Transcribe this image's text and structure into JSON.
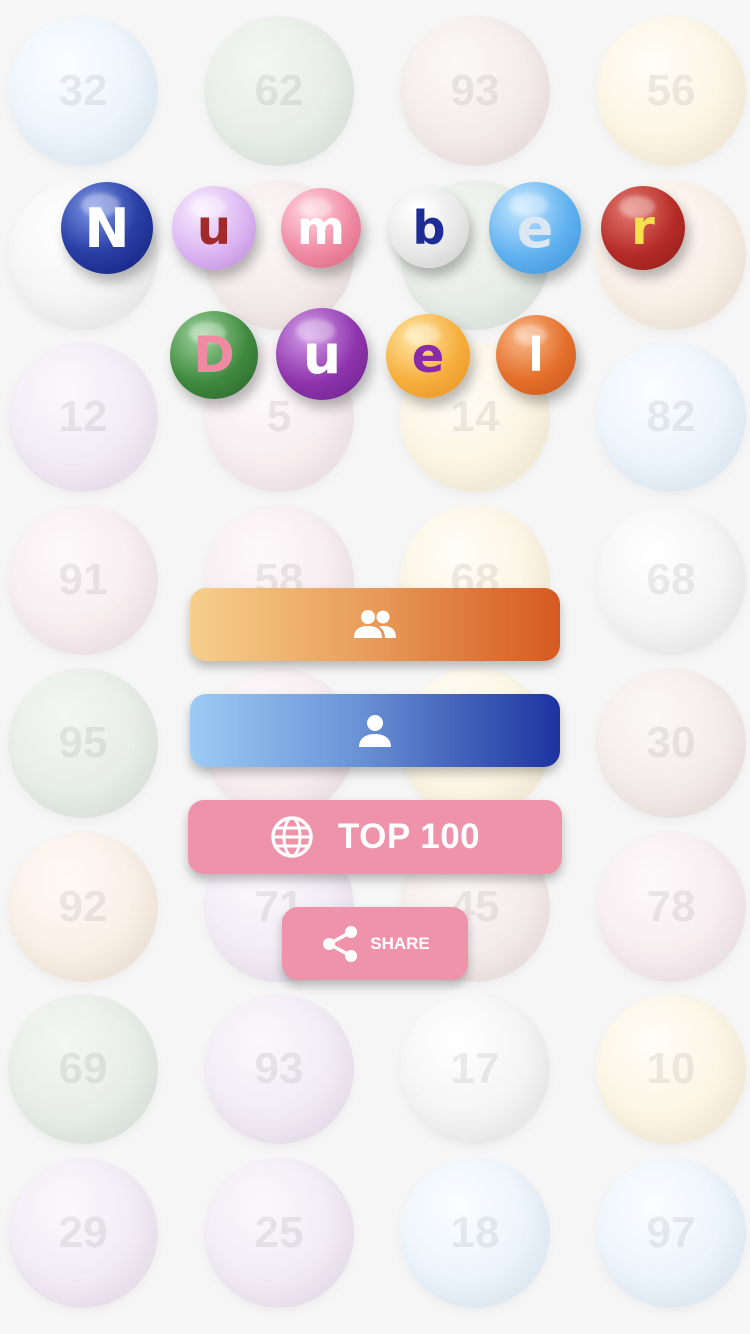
{
  "background_numbers": [
    [
      "32",
      "62",
      "93",
      "56"
    ],
    [
      "",
      "",
      "",
      ""
    ],
    [
      "12",
      "5",
      "14",
      "82"
    ],
    [
      "91",
      "58",
      "68",
      "68"
    ],
    [
      "95",
      "",
      "",
      "30"
    ],
    [
      "92",
      "71",
      "45",
      "78"
    ],
    [
      "69",
      "93",
      "17",
      "10"
    ],
    [
      "29",
      "25",
      "18",
      "97"
    ]
  ],
  "title": {
    "line1": [
      "N",
      "u",
      "m",
      "b",
      "e",
      "r"
    ],
    "line2": [
      "D",
      "u",
      "e",
      "l"
    ]
  },
  "buttons": {
    "multiplayer_icon": "group-icon",
    "single_player_icon": "person-icon",
    "top100_label": "TOP 100",
    "top100_icon": "globe-icon",
    "share_label": "SHARE",
    "share_icon": "share-icon"
  },
  "colors": {
    "pink_button": "#ef93ab",
    "orange_gradient_start": "#f7cf8c",
    "orange_gradient_end": "#d65a20",
    "blue_gradient_start": "#9ccbf4",
    "blue_gradient_end": "#1d33a0"
  }
}
